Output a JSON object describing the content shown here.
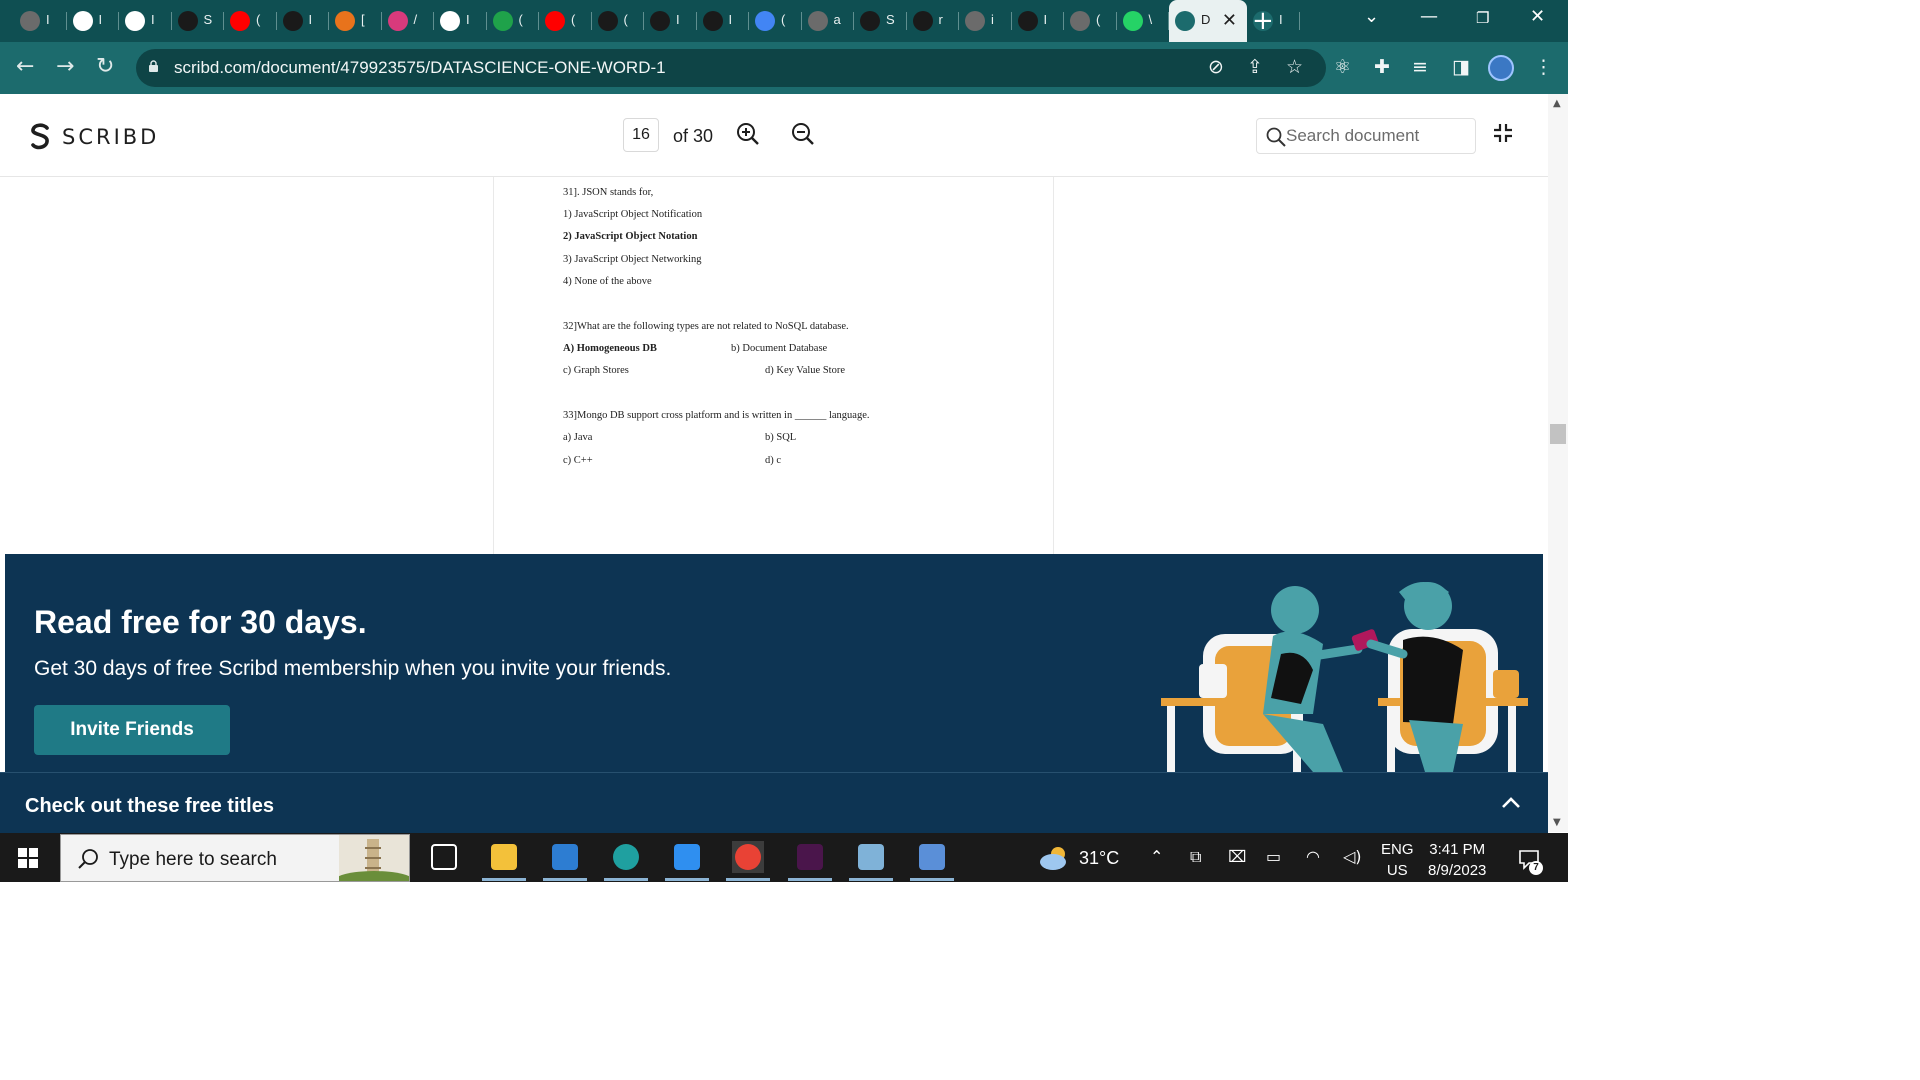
{
  "browser": {
    "tabs": [
      {
        "icon": "chatgpt-icon",
        "label": "I",
        "color": "#6b6b6b"
      },
      {
        "icon": "next-icon",
        "label": "I",
        "color": "#ffffff"
      },
      {
        "icon": "google-icon",
        "label": "I",
        "color": "#ffffff"
      },
      {
        "icon": "github-icon",
        "label": "S",
        "color": "#1a1a1a"
      },
      {
        "icon": "youtube-icon",
        "label": "(",
        "color": "#ff0000"
      },
      {
        "icon": "github-icon",
        "label": "I",
        "color": "#1a1a1a"
      },
      {
        "icon": "copy-icon",
        "label": "[",
        "color": "#e8731c"
      },
      {
        "icon": "heart-app-icon",
        "label": "/",
        "color": "#d83a7c"
      },
      {
        "icon": "gmail-icon",
        "label": "I",
        "color": "#ffffff"
      },
      {
        "icon": "plus-app-icon",
        "label": "(",
        "color": "#1fa24a"
      },
      {
        "icon": "youtube-icon",
        "label": "(",
        "color": "#ff0000"
      },
      {
        "icon": "github-icon",
        "label": "(",
        "color": "#1a1a1a"
      },
      {
        "icon": "github-icon",
        "label": "I",
        "color": "#1a1a1a"
      },
      {
        "icon": "dash-icon",
        "label": "I",
        "color": "#1a1a1a"
      },
      {
        "icon": "docs-icon",
        "label": "(",
        "color": "#4285f4"
      },
      {
        "icon": "globe-icon",
        "label": "a",
        "color": "#6b6b6b"
      },
      {
        "icon": "dash-icon",
        "label": "S",
        "color": "#1a1a1a"
      },
      {
        "icon": "github-icon",
        "label": "r",
        "color": "#1a1a1a"
      },
      {
        "icon": "globe-icon",
        "label": "i",
        "color": "#6b6b6b"
      },
      {
        "icon": "react-icon",
        "label": "I",
        "color": "#1a1a1a"
      },
      {
        "icon": "globe-icon",
        "label": "(",
        "color": "#6b6b6b"
      },
      {
        "icon": "whatsapp-icon",
        "label": "\\",
        "color": "#25d366"
      },
      {
        "icon": "scribd-icon",
        "label": "I",
        "color": "#1c6b6d",
        "active": true
      },
      {
        "icon": "scribd-icon",
        "label": "I",
        "color": "#1c6b6d"
      }
    ],
    "active_tab_label": "D",
    "url": "scribd.com/document/479923575/DATASCIENCE-ONE-WORD-1"
  },
  "scribd": {
    "logo": "SCRIBD",
    "page_current": "16",
    "page_total": "of 30",
    "search_placeholder": "Search document"
  },
  "document": {
    "lines": [
      {
        "text": "31]. JSON stands for,",
        "bold": false
      },
      {
        "text": "1) JavaScript Object Notification",
        "bold": false
      },
      {
        "text": "2) JavaScript Object Notation",
        "bold": true
      },
      {
        "text": "3) JavaScript Object Networking",
        "bold": false
      },
      {
        "text": "4) None of the above",
        "bold": false
      },
      {
        "text": "32]What are the following types are not related to NoSQL database.",
        "bold": false
      },
      {
        "text": "A) Homogeneous DB",
        "bold": true
      },
      {
        "text": "b) Document Database",
        "bold": false
      },
      {
        "text": "c) Graph Stores",
        "bold": false
      },
      {
        "text": "d) Key Value Store",
        "bold": false
      },
      {
        "text": "33]Mongo DB support cross platform and is written in ______ language.",
        "bold": false
      },
      {
        "text": "a) Java",
        "bold": false
      },
      {
        "text": "b) SQL",
        "bold": false
      },
      {
        "text": "c) C++",
        "bold": false
      },
      {
        "text": "d) c",
        "bold": false
      }
    ]
  },
  "promo": {
    "title": "Read free for 30 days.",
    "subtitle": "Get 30 days of free Scribd membership when you invite your friends.",
    "button": "Invite Friends",
    "free_titles": "Check out these free titles"
  },
  "taskbar": {
    "search_placeholder": "Type here to search",
    "apps": [
      "task-view-icon",
      "file-explorer-icon",
      "microsoft-store-icon",
      "edge-icon",
      "vscode-icon",
      "chrome-icon",
      "slack-icon",
      "notepad-icon",
      "wordpad-icon"
    ],
    "temperature": "31°C",
    "lang_top": "ENG",
    "lang_bottom": "US",
    "time": "3:41 PM",
    "date": "8/9/2023",
    "notification_count": "7"
  },
  "colors": {
    "tab_strip": "#0f4f52",
    "address_bar": "#1c6b6d",
    "banner": "#0d3453",
    "button": "#1f7a86"
  }
}
